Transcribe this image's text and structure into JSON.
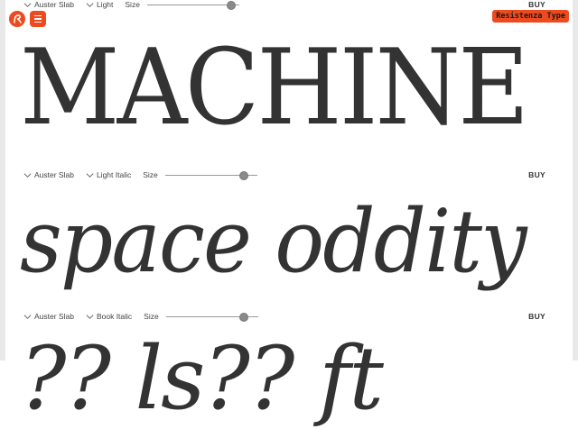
{
  "brand": {
    "name": "Resistenza Type",
    "accent": "#ee4a1f",
    "logo_icon": "resistenza-logo-icon",
    "menu_icon": "hamburger-icon"
  },
  "rows": [
    {
      "family": "Auster Slab",
      "style": "Light",
      "size_label": "Size",
      "size_level": 0.9,
      "buy_label": "BUY",
      "specimen": "MACHINE"
    },
    {
      "family": "Auster Slab",
      "style": "Light Italic",
      "size_label": "Size",
      "size_level": 0.85,
      "buy_label": "BUY",
      "specimen": "space oddity"
    },
    {
      "family": "Auster Slab",
      "style": "Book Italic",
      "size_label": "Size",
      "size_level": 0.84,
      "buy_label": "BUY",
      "specimen": "?? ls?? ft"
    }
  ]
}
